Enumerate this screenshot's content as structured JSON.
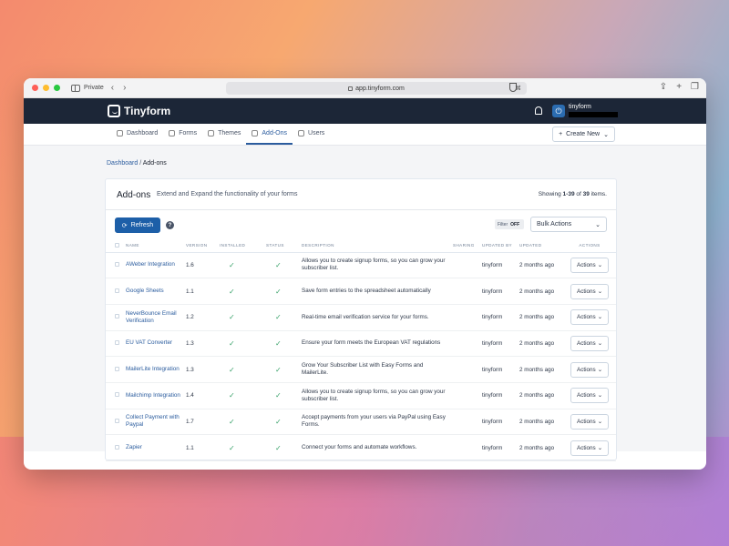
{
  "browser": {
    "private_label": "Private",
    "url": "app.tinyform.com",
    "url_right": "⌘"
  },
  "app": {
    "logo_text": "Tinyform",
    "user_name": "tinyform"
  },
  "subnav": {
    "items": [
      {
        "label": "Dashboard",
        "icon": "home-icon"
      },
      {
        "label": "Forms",
        "icon": "form-icon"
      },
      {
        "label": "Themes",
        "icon": "palette-icon"
      },
      {
        "label": "Add-Ons",
        "icon": "puzzle-icon",
        "active": true
      },
      {
        "label": "Users",
        "icon": "users-icon"
      }
    ],
    "create_label": "Create New"
  },
  "breadcrumb": {
    "parent": "Dashboard",
    "separator": "/",
    "current": "Add-ons"
  },
  "card": {
    "title": "Add-ons",
    "subtitle": "Extend and Expand the functionality of your forms",
    "showing_prefix": "Showing",
    "showing_range": "1-39",
    "showing_of": "of",
    "showing_total": "39",
    "showing_suffix": "items."
  },
  "toolbar": {
    "refresh_label": "Refresh",
    "help": "?",
    "filter_label": "Filter",
    "filter_state": "OFF",
    "bulk_actions": "Bulk Actions"
  },
  "table": {
    "headers": {
      "name": "Name",
      "version": "Version",
      "installed": "Installed",
      "status": "Status",
      "description": "Description",
      "sharing": "Sharing",
      "updated_by": "Updated By",
      "updated": "Updated",
      "actions": "Actions"
    },
    "rows": [
      {
        "name": "AWeber Integration",
        "version": "1.6",
        "description": "Allows you to create signup forms, so you can grow your subscriber list.",
        "updated_by": "tinyform",
        "updated": "2 months ago",
        "action": "Actions"
      },
      {
        "name": "Google Sheets",
        "version": "1.1",
        "description": "Save form entries to the spreadsheet automatically",
        "updated_by": "tinyform",
        "updated": "2 months ago",
        "action": "Actions"
      },
      {
        "name": "NeverBounce Email Verification",
        "version": "1.2",
        "description": "Real-time email verification service for your forms.",
        "updated_by": "tinyform",
        "updated": "2 months ago",
        "action": "Actions"
      },
      {
        "name": "EU VAT Converter",
        "version": "1.3",
        "description": "Ensure your form meets the European VAT regulations",
        "updated_by": "tinyform",
        "updated": "2 months ago",
        "action": "Actions"
      },
      {
        "name": "MailerLite Integration",
        "version": "1.3",
        "description": "Grow Your Subscriber List with Easy Forms and MailerLite.",
        "updated_by": "tinyform",
        "updated": "2 months ago",
        "action": "Actions"
      },
      {
        "name": "Mailchimp Integration",
        "version": "1.4",
        "description": "Allows you to create signup forms, so you can grow your subscriber list.",
        "updated_by": "tinyform",
        "updated": "2 months ago",
        "action": "Actions"
      },
      {
        "name": "Collect Payment with Paypal",
        "version": "1.7",
        "description": "Accept payments from your users via PayPal using Easy Forms.",
        "updated_by": "tinyform",
        "updated": "2 months ago",
        "action": "Actions"
      },
      {
        "name": "Zapier",
        "version": "1.1",
        "description": "Connect your forms and automate workflows.",
        "updated_by": "tinyform",
        "updated": "2 months ago",
        "action": "Actions"
      }
    ]
  },
  "colors": {
    "header_bg": "#1c2637",
    "accent": "#1d5fa8",
    "link": "#2b5c9e",
    "check": "#38a169"
  }
}
